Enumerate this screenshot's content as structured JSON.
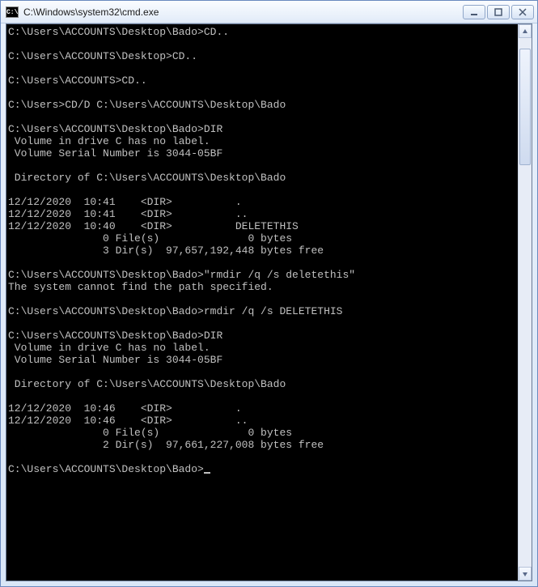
{
  "window": {
    "title": "C:\\Windows\\system32\\cmd.exe",
    "icon_text": "C:\\"
  },
  "console": {
    "lines": [
      "C:\\Users\\ACCOUNTS\\Desktop\\Bado>CD..",
      "",
      "C:\\Users\\ACCOUNTS\\Desktop>CD..",
      "",
      "C:\\Users\\ACCOUNTS>CD..",
      "",
      "C:\\Users>CD/D C:\\Users\\ACCOUNTS\\Desktop\\Bado",
      "",
      "C:\\Users\\ACCOUNTS\\Desktop\\Bado>DIR",
      " Volume in drive C has no label.",
      " Volume Serial Number is 3044-05BF",
      "",
      " Directory of C:\\Users\\ACCOUNTS\\Desktop\\Bado",
      "",
      "12/12/2020  10:41    <DIR>          .",
      "12/12/2020  10:41    <DIR>          ..",
      "12/12/2020  10:40    <DIR>          DELETETHIS",
      "               0 File(s)              0 bytes",
      "               3 Dir(s)  97,657,192,448 bytes free",
      "",
      "C:\\Users\\ACCOUNTS\\Desktop\\Bado>\"rmdir /q /s deletethis\"",
      "The system cannot find the path specified.",
      "",
      "C:\\Users\\ACCOUNTS\\Desktop\\Bado>rmdir /q /s DELETETHIS",
      "",
      "C:\\Users\\ACCOUNTS\\Desktop\\Bado>DIR",
      " Volume in drive C has no label.",
      " Volume Serial Number is 3044-05BF",
      "",
      " Directory of C:\\Users\\ACCOUNTS\\Desktop\\Bado",
      "",
      "12/12/2020  10:46    <DIR>          .",
      "12/12/2020  10:46    <DIR>          ..",
      "               0 File(s)              0 bytes",
      "               2 Dir(s)  97,661,227,008 bytes free",
      "",
      "C:\\Users\\ACCOUNTS\\Desktop\\Bado>"
    ]
  }
}
